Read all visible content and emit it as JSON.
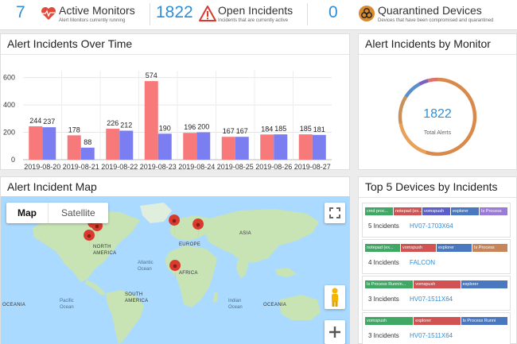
{
  "stats": [
    {
      "value": "7",
      "label": "Active Monitors",
      "sub": "Alert Monitors currently running",
      "icon": "heart-pulse-icon"
    },
    {
      "value": "1822",
      "label": "Open Incidents",
      "sub": "Incidents that are currently active",
      "icon": "warning-triangle-icon"
    },
    {
      "value": "0",
      "label": "Quarantined Devices",
      "sub": "Devices that have been compromised and quarantined",
      "icon": "biohazard-icon"
    }
  ],
  "panels": {
    "incidents_over_time": "Alert Incidents Over Time",
    "by_monitor": "Alert Incidents by Monitor",
    "map": "Alert Incident Map",
    "top_devices": "Top 5 Devices by Incidents"
  },
  "chart_data": {
    "type": "bar",
    "categories": [
      "2019-08-20",
      "2019-08-21",
      "2019-08-22",
      "2019-08-23",
      "2019-08-24",
      "2019-08-25",
      "2019-08-26",
      "2019-08-27"
    ],
    "series": [
      {
        "values": [
          244,
          178,
          226,
          574,
          196,
          167,
          184,
          185
        ],
        "color": "#f87979"
      },
      {
        "values": [
          237,
          88,
          212,
          190,
          200,
          167,
          185,
          181
        ],
        "color": "#7b7ef0"
      }
    ],
    "yticks": [
      0,
      200,
      400,
      600
    ],
    "ylim": [
      0,
      650
    ],
    "grid": true,
    "title": "Alert Incidents Over Time",
    "xlabel": "",
    "ylabel": ""
  },
  "donut": {
    "total": "1822",
    "label": "Total Alerts",
    "segments": [
      {
        "value": 0.55,
        "color": "#d9894a"
      },
      {
        "value": 0.17,
        "color": "#e9a15a"
      },
      {
        "value": 0.12,
        "color": "#c9905a"
      },
      {
        "value": 0.08,
        "color": "#5b8fc9"
      },
      {
        "value": 0.04,
        "color": "#7b5fc2"
      },
      {
        "value": 0.04,
        "color": "#e07070"
      }
    ]
  },
  "map": {
    "toggle_map": "Map",
    "toggle_satellite": "Satellite",
    "labels": {
      "north_america": "NORTH\nAMERICA",
      "south_america": "SOUTH\nAMERICA",
      "europe": "EUROPE",
      "asia": "ASIA",
      "africa": "AFRICA",
      "atlantic": "Atlantic\nOcean",
      "pacific": "Pacific\nOcean",
      "indian": "Indian\nOcean",
      "oceania_left": "OCEANIA",
      "oceania_right": "OCEANIA"
    },
    "colors": {
      "water": "#aadaff",
      "land": "#c8e4b4",
      "pin": "#d93a2f"
    }
  },
  "top_devices": [
    {
      "count": "5 Incidents",
      "name": "HV07-1703X64",
      "segments": [
        {
          "label": "cmd proc...",
          "w": 0.2,
          "color": "#3fa865"
        },
        {
          "label": "notepad (ex...",
          "w": 0.2,
          "color": "#d05252"
        },
        {
          "label": "vomspush",
          "w": 0.2,
          "color": "#5c5fc8"
        },
        {
          "label": "explorer",
          "w": 0.2,
          "color": "#4a78c0"
        },
        {
          "label": "Is Process",
          "w": 0.2,
          "color": "#9a7bd8"
        }
      ]
    },
    {
      "count": "4 Incidents",
      "name": "FALCON",
      "segments": [
        {
          "label": "notepad (ex...",
          "w": 0.25,
          "color": "#3fa865"
        },
        {
          "label": "vomspush",
          "w": 0.25,
          "color": "#d05252"
        },
        {
          "label": "explorer",
          "w": 0.25,
          "color": "#4a78c0"
        },
        {
          "label": "Is Process",
          "w": 0.25,
          "color": "#c8855a"
        }
      ]
    },
    {
      "count": "3 Incidents",
      "name": "HV07-1511X64",
      "segments": [
        {
          "label": "Is Process Runnin...",
          "w": 0.34,
          "color": "#3fa865"
        },
        {
          "label": "vomspush",
          "w": 0.33,
          "color": "#d05252"
        },
        {
          "label": "explorer",
          "w": 0.33,
          "color": "#4a78c0"
        }
      ]
    },
    {
      "count": "3 Incidents",
      "name": "HV07-1511X64",
      "segments": [
        {
          "label": "vomspush",
          "w": 0.34,
          "color": "#3fa865"
        },
        {
          "label": "explorer",
          "w": 0.33,
          "color": "#d05252"
        },
        {
          "label": "Is Process Runni",
          "w": 0.33,
          "color": "#4a78c0"
        }
      ]
    }
  ]
}
